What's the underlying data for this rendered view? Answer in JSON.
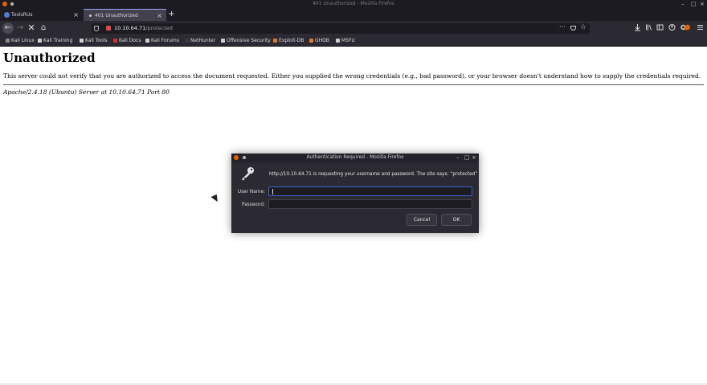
{
  "window": {
    "title": "401 Unauthorized - Mozilla Firefox",
    "controls": {
      "minimize": "–",
      "maximize": "□",
      "close": "×"
    }
  },
  "tabs": [
    {
      "title": "ToolsRUs",
      "close": "×"
    },
    {
      "title": "401 Unauthorized",
      "close": "×",
      "active": true
    }
  ],
  "new_tab": "+",
  "nav": {
    "back": "←",
    "forward": "→",
    "stop": "✕",
    "home": "⌂",
    "url_host": "10.10.64.71",
    "url_path": "/protected",
    "page_actions": "···",
    "bookmark_star": "☆"
  },
  "toolbar_icons": [
    "download-icon",
    "library-icon",
    "sidebar-icon",
    "account-icon",
    "extensions-icon",
    "firefox-icon",
    "menu-icon"
  ],
  "bookmarks": [
    {
      "label": "Kali Linux",
      "color": "#8a8a8a"
    },
    {
      "label": "Kali Training",
      "color": "#cfcfcf"
    },
    {
      "label": "Kali Tools",
      "color": "#cfcfcf"
    },
    {
      "label": "Kali Docs",
      "color": "#d9302c"
    },
    {
      "label": "Kali Forums",
      "color": "#cfcfcf"
    },
    {
      "label": "NetHunter",
      "color": "#3a3a3a"
    },
    {
      "label": "Offensive Security",
      "color": "#cfcfcf"
    },
    {
      "label": "Exploit-DB",
      "color": "#e07b2a"
    },
    {
      "label": "GHDB",
      "color": "#e07b2a"
    },
    {
      "label": "MSFU",
      "color": "#cfcfcf"
    }
  ],
  "page": {
    "heading": "Unauthorized",
    "message": "This server could not verify that you are authorized to access the document requested. Either you supplied the wrong credentials (e.g., bad password), or your browser doesn't understand how to supply the credentials required.",
    "address": "Apache/2.4.18 (Ubuntu) Server at 10.10.64.71 Port 80"
  },
  "dialog": {
    "title": "Authentication Required - Mozilla Firefox",
    "message": "http://10.10.64.71 is requesting your username and password. The site says: “protected”",
    "username_label": "User Name:",
    "username_value": "",
    "password_label": "Password:",
    "password_value": "",
    "cancel_label": "Cancel",
    "ok_label": "OK"
  },
  "colors": {
    "chrome_dark": "#1c1b22",
    "toolbar": "#2b2a33",
    "focus_ring": "#3c64d8",
    "firefox_orange": "#e66000"
  }
}
